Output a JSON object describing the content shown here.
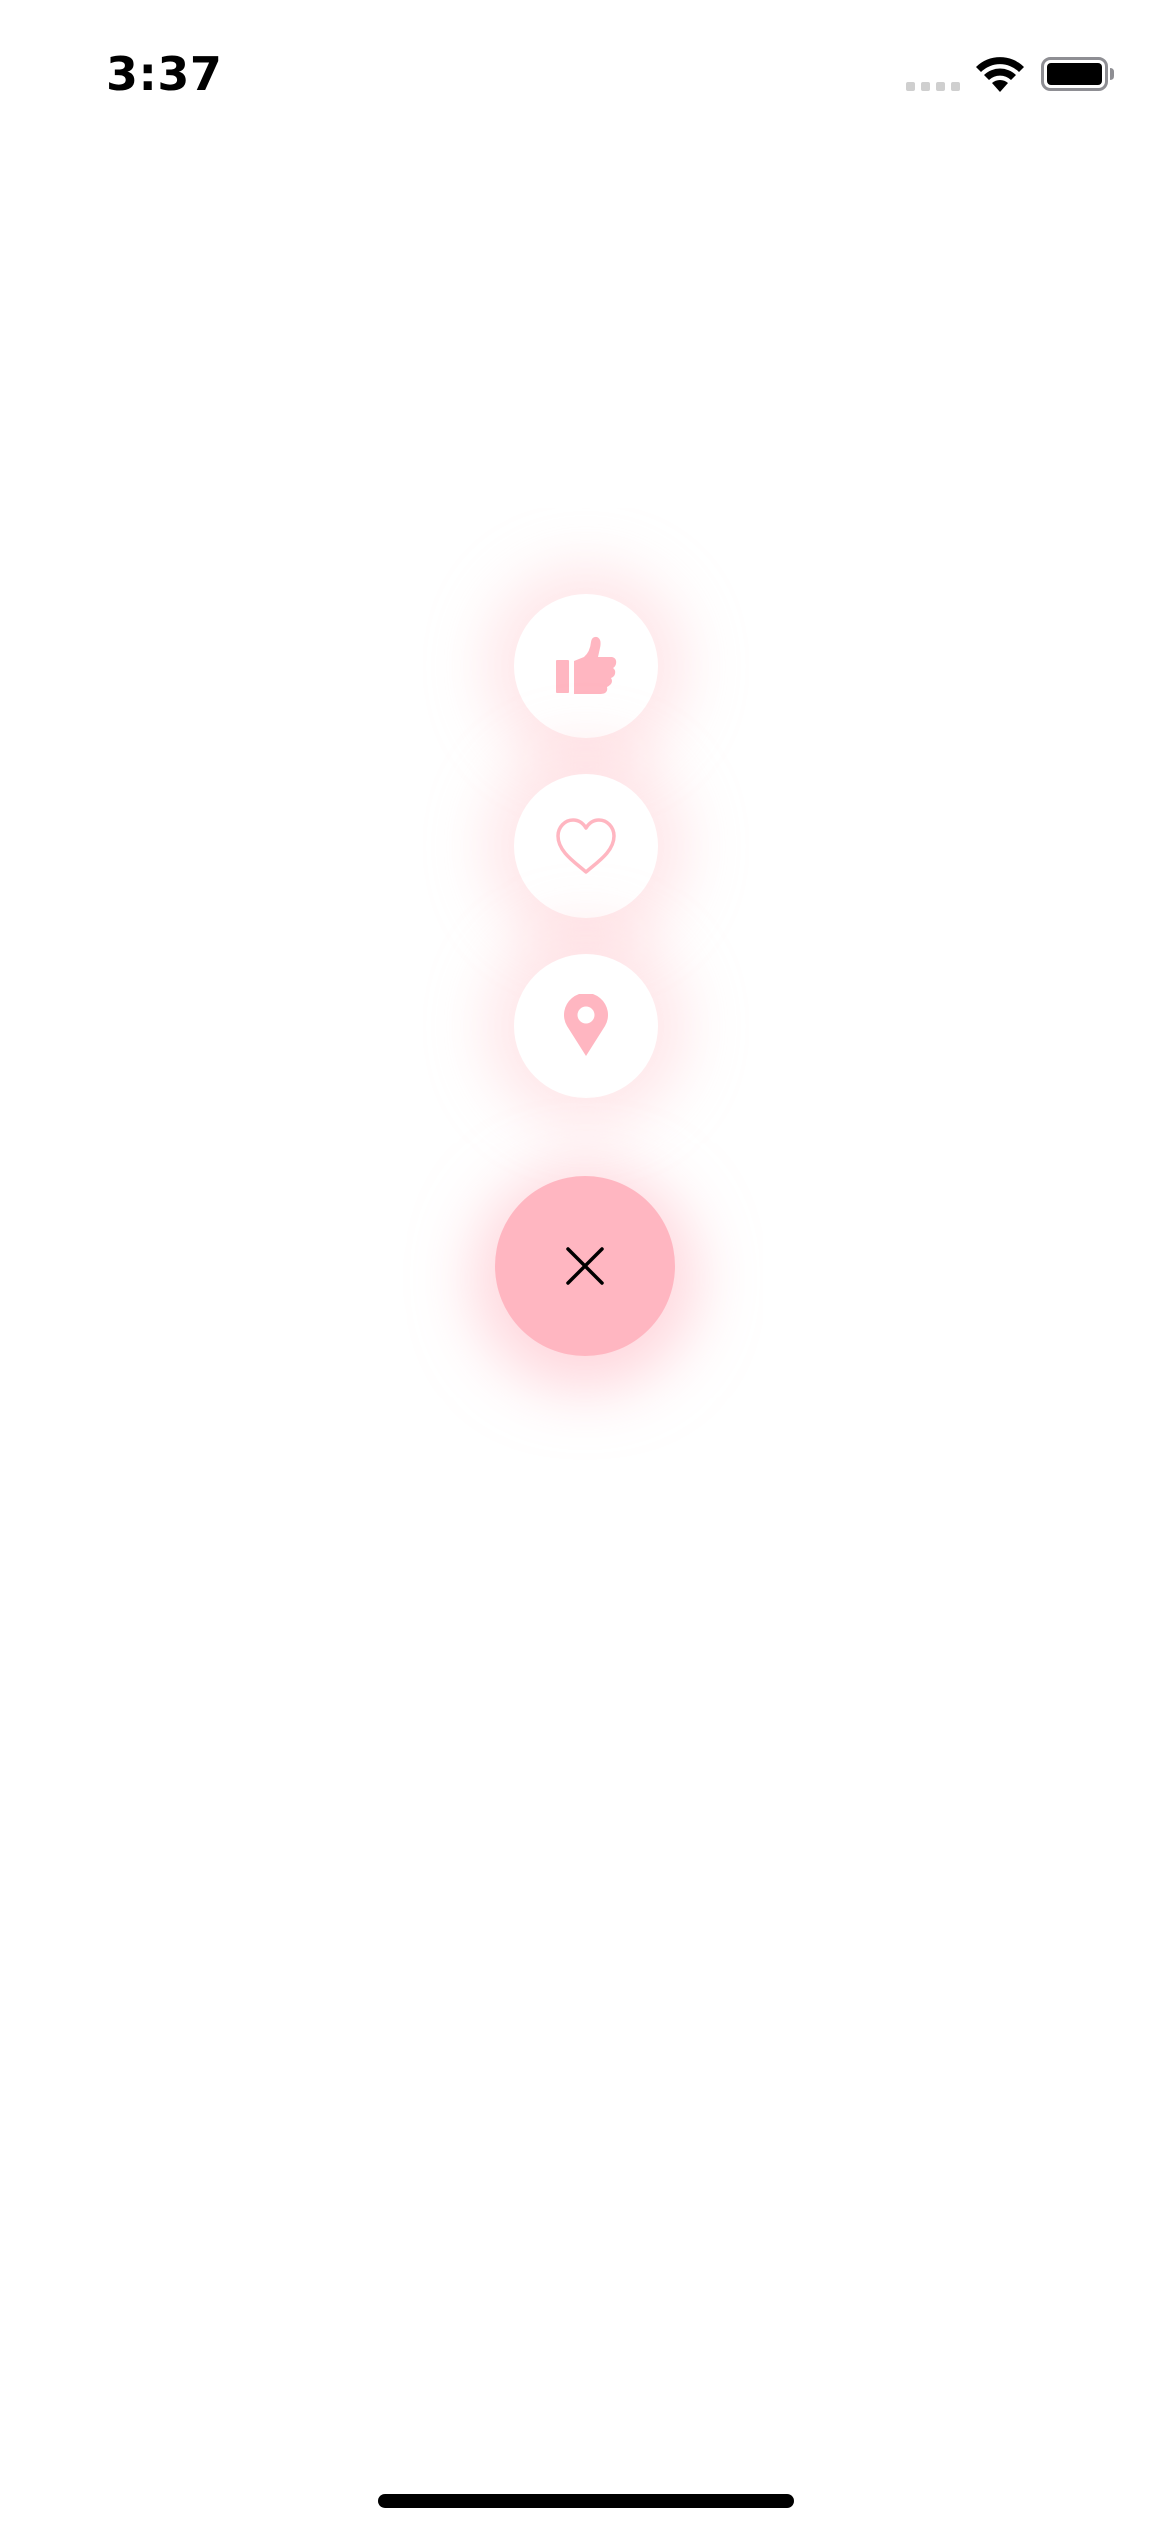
{
  "status_bar": {
    "time": "3:37",
    "signal_icon": "cellular-no-service-icon",
    "wifi_icon": "wifi-icon",
    "battery_icon": "battery-full-icon"
  },
  "fab_menu": {
    "expanded": true,
    "accent_color": "#ffb6c1",
    "items": [
      {
        "name": "like",
        "icon": "thumbs-up-icon"
      },
      {
        "name": "favorite",
        "icon": "heart-outline-icon"
      },
      {
        "name": "location",
        "icon": "map-pin-icon"
      }
    ],
    "main_button": {
      "icon": "close-icon",
      "icon_color": "#000000"
    }
  },
  "home_indicator": "home-indicator-bar"
}
